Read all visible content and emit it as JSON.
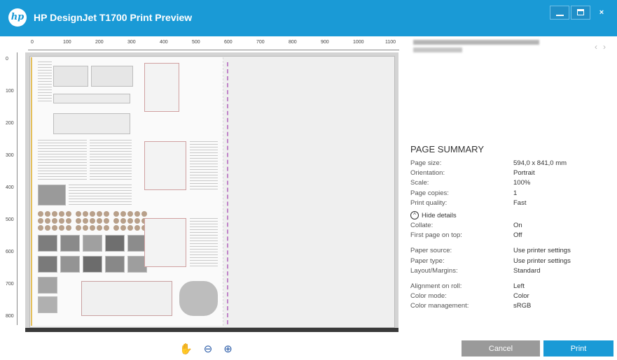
{
  "window": {
    "title": "HP DesignJet T1700 Print Preview",
    "logo_text": "hp",
    "close_glyph": "×"
  },
  "ruler": {
    "h_labels": [
      "0",
      "100",
      "200",
      "300",
      "400",
      "500",
      "600",
      "700",
      "800",
      "900",
      "1000",
      "1100"
    ],
    "v_labels": [
      "0",
      "100",
      "200",
      "300",
      "400",
      "500",
      "600",
      "700",
      "800"
    ]
  },
  "preview_tools": [
    {
      "name": "hand-tool-icon",
      "glyph": "✋"
    },
    {
      "name": "zoom-out-icon",
      "glyph": "⊖"
    },
    {
      "name": "zoom-in-icon",
      "glyph": "⊕"
    }
  ],
  "side": {
    "nav_prev": "‹",
    "nav_next": "›"
  },
  "summary": {
    "title": "PAGE SUMMARY",
    "basic": [
      {
        "label": "Page size:",
        "value": "594,0 x 841,0 mm"
      },
      {
        "label": "Orientation:",
        "value": "Portrait"
      },
      {
        "label": "Scale:",
        "value": "100%"
      },
      {
        "label": "Page copies:",
        "value": "1"
      },
      {
        "label": "Print quality:",
        "value": "Fast"
      }
    ],
    "hide_details": "Hide details",
    "details_1": [
      {
        "label": "Collate:",
        "value": "On"
      },
      {
        "label": "First page on top:",
        "value": "Off"
      }
    ],
    "details_2": [
      {
        "label": "Paper source:",
        "value": "Use printer settings"
      },
      {
        "label": "Paper type:",
        "value": "Use printer settings"
      },
      {
        "label": "Layout/Margins:",
        "value": "Standard"
      }
    ],
    "details_3": [
      {
        "label": "Alignment on roll:",
        "value": "Left"
      },
      {
        "label": "Color mode:",
        "value": "Color"
      },
      {
        "label": "Color management:",
        "value": "sRGB"
      }
    ]
  },
  "buttons": {
    "cancel": "Cancel",
    "print": "Print"
  },
  "colors": {
    "accent": "#1a9ad6",
    "cancel_bg": "#9a9a9a",
    "cut_line": "#c084c8"
  }
}
